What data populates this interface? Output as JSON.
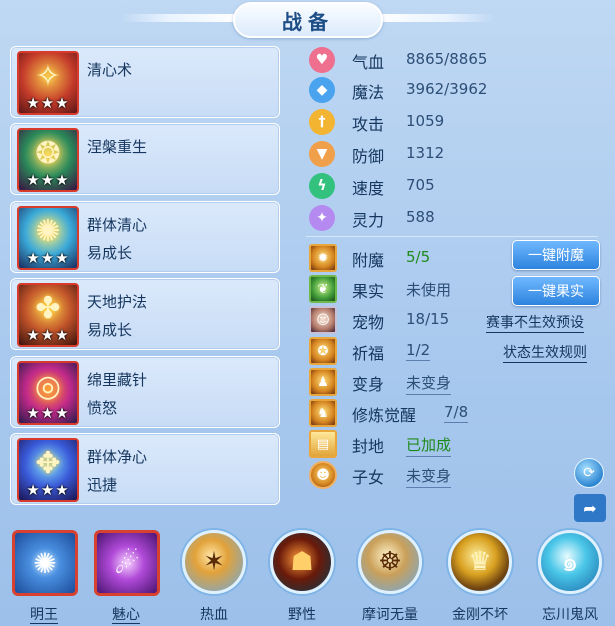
{
  "title": "战备",
  "skills": [
    {
      "name": "清心术",
      "sub": "",
      "stars": "★★★",
      "glyph": "✧"
    },
    {
      "name": "涅槃重生",
      "sub": "",
      "stars": "★★★",
      "glyph": "❂"
    },
    {
      "name": "群体清心",
      "sub": "易成长",
      "stars": "★★★",
      "glyph": "✺"
    },
    {
      "name": "天地护法",
      "sub": "易成长",
      "stars": "★★★",
      "glyph": "✤"
    },
    {
      "name": "绵里藏针",
      "sub": "愤怒",
      "stars": "★★★",
      "glyph": "◎"
    },
    {
      "name": "群体净心",
      "sub": "迅捷",
      "stars": "★★★",
      "glyph": "✥"
    }
  ],
  "stats": [
    {
      "label": "气血",
      "value": "8865/8865",
      "icon": "heart-icon",
      "glyph": "♥",
      "color": "#ef6f8e"
    },
    {
      "label": "魔法",
      "value": "3962/3962",
      "icon": "magic-icon",
      "glyph": "◆",
      "color": "#4aa3ee"
    },
    {
      "label": "攻击",
      "value": "1059",
      "icon": "sword-icon",
      "glyph": "†",
      "color": "#f2b431"
    },
    {
      "label": "防御",
      "value": "1312",
      "icon": "shield-icon",
      "glyph": "▼",
      "color": "#f0a04a"
    },
    {
      "label": "速度",
      "value": "705",
      "icon": "lightning-icon",
      "glyph": "ϟ",
      "color": "#33c27e"
    },
    {
      "label": "灵力",
      "value": "588",
      "icon": "spirit-icon",
      "glyph": "✦",
      "color": "#b58af0"
    }
  ],
  "extras": [
    {
      "label": "附魔",
      "value": "5/5",
      "icon": "enchant-icon",
      "glyph": "✹"
    },
    {
      "label": "果实",
      "value": "未使用",
      "icon": "fruit-icon",
      "glyph": "❦"
    },
    {
      "label": "宠物",
      "value": "18/15",
      "icon": "pet-icon",
      "glyph": "☺"
    },
    {
      "label": "祈福",
      "value": "1/2",
      "icon": "blessing-icon",
      "glyph": "✪"
    },
    {
      "label": "变身",
      "value": "未变身",
      "icon": "transform-icon",
      "glyph": "♟"
    },
    {
      "label": "修炼觉醒",
      "value": "7/8",
      "icon": "cultivation-icon",
      "glyph": "♞"
    },
    {
      "label": "封地",
      "value": "已加成",
      "icon": "fief-icon",
      "glyph": "▤"
    },
    {
      "label": "子女",
      "value": "未变身",
      "icon": "child-icon",
      "glyph": "☻"
    }
  ],
  "buttons": {
    "enchant_all": "一键附魔",
    "fruit_all": "一键果实",
    "event_preset": "赛事不生效预设",
    "status_rules": "状态生效规则"
  },
  "formations": [
    {
      "label": "明王",
      "icon": "mingwang-formation-icon",
      "glyph": "✺",
      "style": "square",
      "bg": "#1c4c9a"
    },
    {
      "label": "魅心",
      "icon": "meixin-formation-icon",
      "glyph": "☄",
      "style": "square",
      "bg": "#7a2fb0"
    },
    {
      "label": "热血",
      "icon": "rexue-formation-icon",
      "glyph": "✶",
      "style": "round"
    },
    {
      "label": "野性",
      "icon": "yexing-formation-icon",
      "glyph": "☗",
      "style": "round"
    },
    {
      "label": "摩诃无量",
      "icon": "mohe-formation-icon",
      "glyph": "☸",
      "style": "round"
    },
    {
      "label": "金刚不坏",
      "icon": "jingang-formation-icon",
      "glyph": "♛",
      "style": "round"
    },
    {
      "label": "忘川鬼风",
      "icon": "wangchuan-formation-icon",
      "glyph": "๑",
      "style": "round"
    }
  ]
}
